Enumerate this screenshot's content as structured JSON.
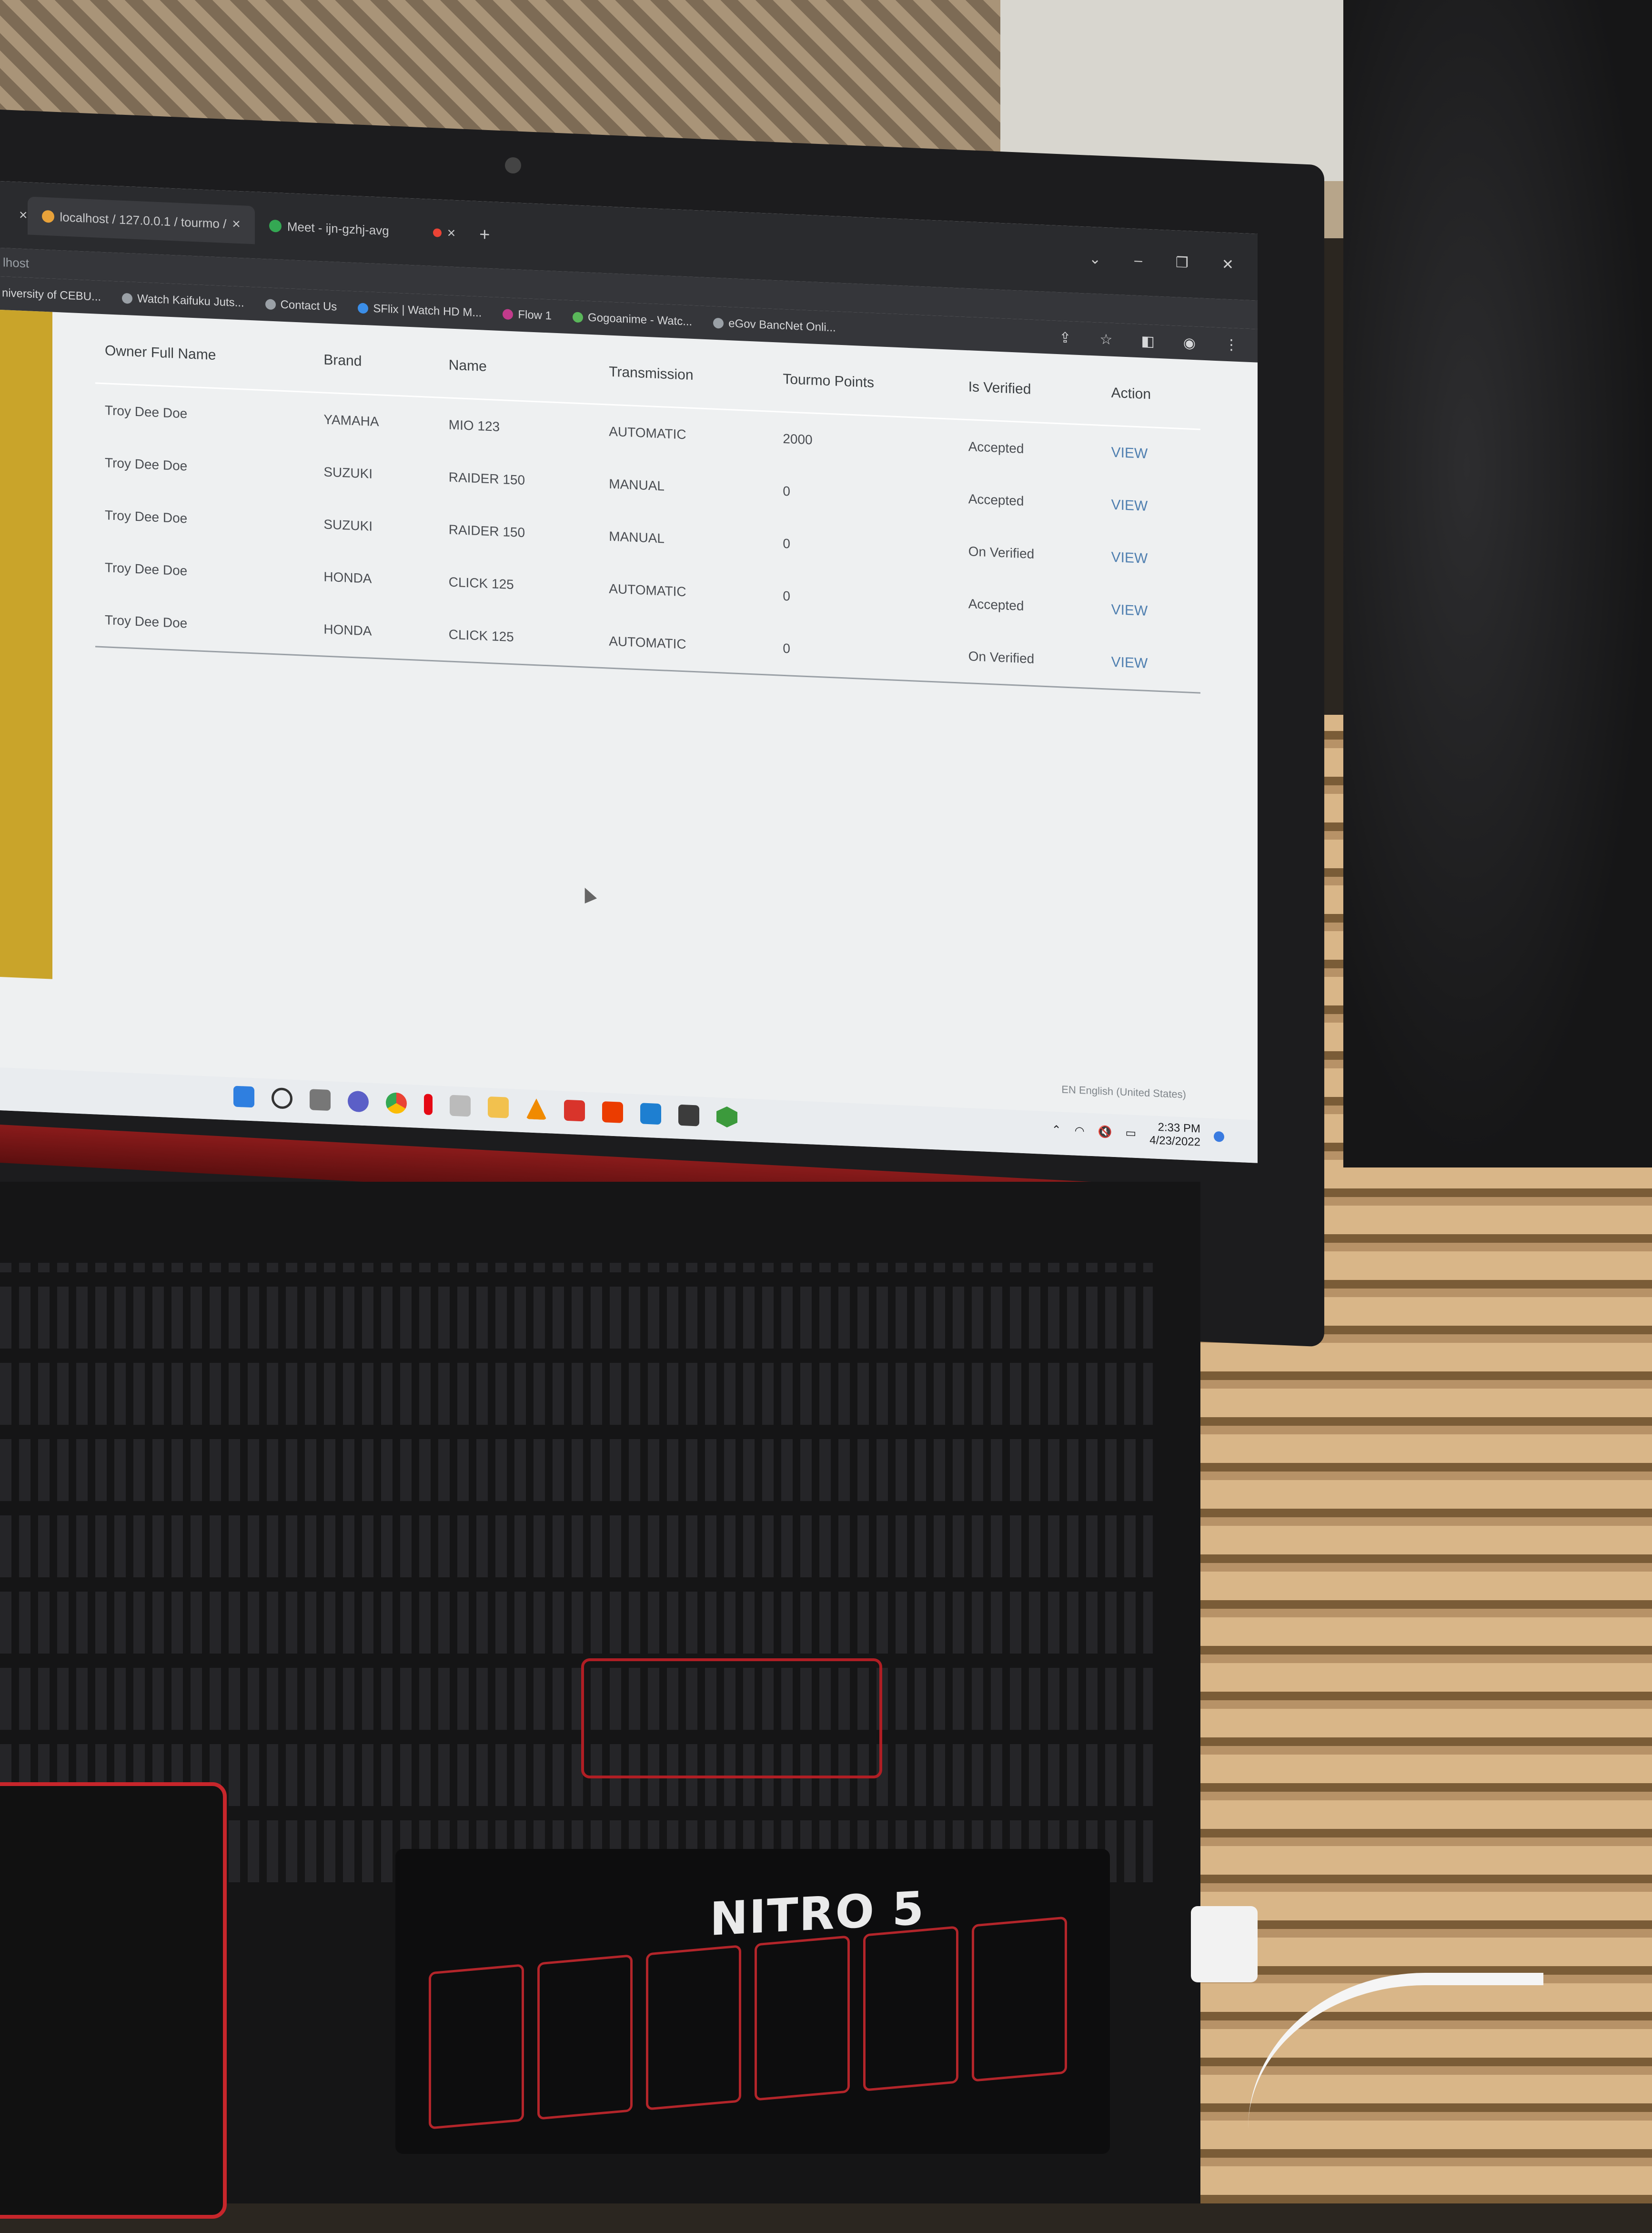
{
  "browser": {
    "tabs": [
      {
        "label": "localhost / 127.0.0.1 / tourmo /",
        "active": true
      },
      {
        "label": "Meet - ijn-gzhj-avg",
        "active": false
      }
    ],
    "new_tab_symbol": "+",
    "close_symbol": "×",
    "address_fragment": "lhost",
    "window_controls": [
      "⌄",
      "–",
      "❐",
      "✕"
    ],
    "bookmarks": [
      "niversity of CEBU...",
      "Watch Kaifuku Juts...",
      "Contact Us",
      "SFlix | Watch HD M...",
      "Flow 1",
      "Gogoanime - Watc...",
      "eGov BancNet Onli..."
    ]
  },
  "table": {
    "headers": [
      "Owner Full Name",
      "Brand",
      "Name",
      "Transmission",
      "Tourmo Points",
      "Is Verified",
      "Action"
    ],
    "rows": [
      [
        "Troy Dee Doe",
        "YAMAHA",
        "MIO 123",
        "AUTOMATIC",
        "2000",
        "Accepted",
        "VIEW"
      ],
      [
        "Troy Dee Doe",
        "SUZUKI",
        "RAIDER 150",
        "MANUAL",
        "0",
        "Accepted",
        "VIEW"
      ],
      [
        "Troy Dee Doe",
        "SUZUKI",
        "RAIDER 150",
        "MANUAL",
        "0",
        "On Verified",
        "VIEW"
      ],
      [
        "Troy Dee Doe",
        "HONDA",
        "CLICK 125",
        "AUTOMATIC",
        "0",
        "Accepted",
        "VIEW"
      ],
      [
        "Troy Dee Doe",
        "HONDA",
        "CLICK 125",
        "AUTOMATIC",
        "0",
        "On Verified",
        "VIEW"
      ]
    ]
  },
  "system": {
    "language": "EN English (United States)",
    "time": "2:33 PM",
    "date": "4/23/2022",
    "taskbar_icons": [
      "windows-start-icon",
      "search-icon",
      "task-view-icon",
      "meet-icon",
      "chrome-icon",
      "netflix-icon",
      "calendar-icon",
      "file-explorer-icon",
      "vlc-icon",
      "wps-icon",
      "office-icon",
      "vscode-icon",
      "terminal-icon",
      "node-icon"
    ]
  },
  "hardware": {
    "brand_label": "NITRO 5"
  },
  "colors": {
    "link": "#4f7fb0",
    "accent_red": "#b01e24",
    "sidebar_yellow": "#c9a42a"
  }
}
